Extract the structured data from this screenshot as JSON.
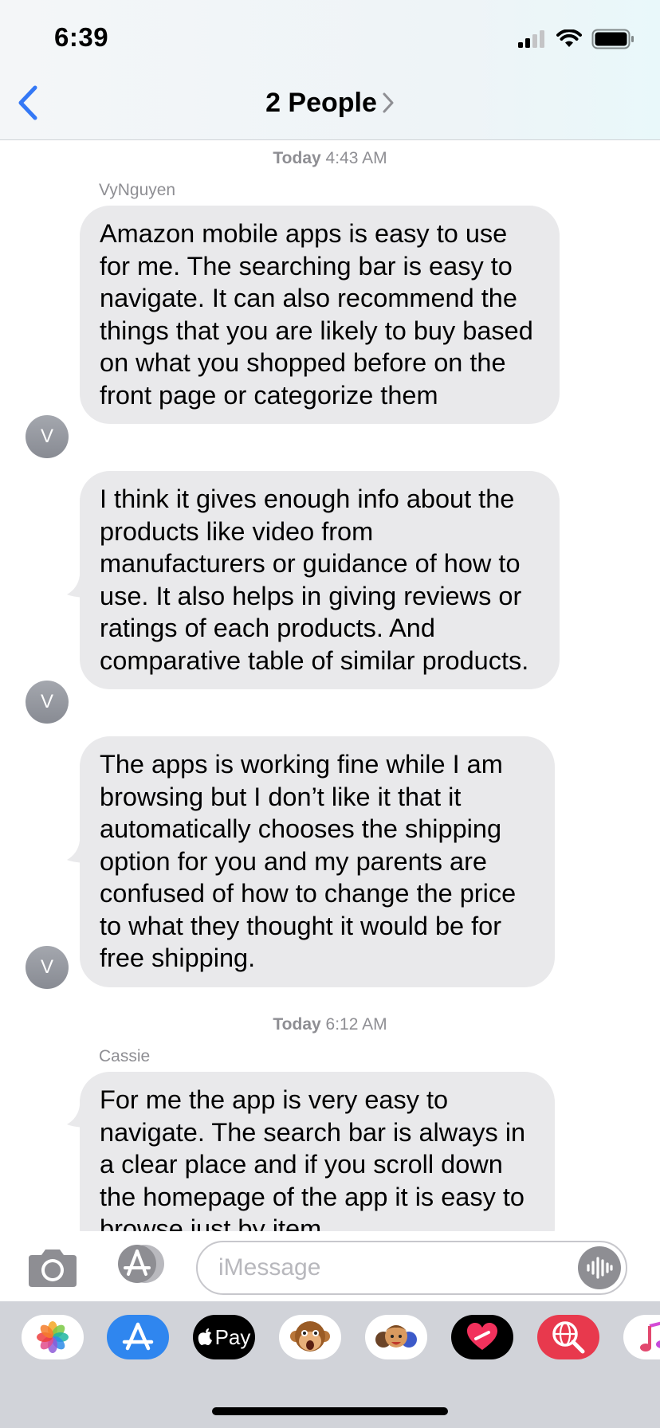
{
  "status_bar": {
    "time": "6:39"
  },
  "nav": {
    "title": "2 People"
  },
  "conversation": {
    "sections": [
      {
        "day": "Today",
        "time": "4:43 AM"
      },
      {
        "day": "Today",
        "time": "6:12 AM"
      }
    ],
    "senders": [
      "VyNguyen",
      "Cassie"
    ],
    "avatar_initial": "V",
    "messages": [
      "Amazon mobile apps is easy to use for me. The searching bar is easy to navigate. It can also recommend the things that you are likely to buy based on what you shopped before on the front page or categorize them",
      "I think it gives enough info about the products like video from manufacturers or guidance of how to use. It also helps in giving reviews or ratings of each products. And comparative table of similar products.",
      "The apps is working fine while I am browsing but I don’t like it that it automatically chooses the shipping option for you and my parents are confused of how to change the price to what they thought it would be for free shipping.",
      "For me the app is very easy to navigate. The search bar is always in a clear place and if you scroll down the homepage of the app it is easy to browse just by item"
    ]
  },
  "input": {
    "placeholder": "iMessage"
  },
  "drawer": {
    "apple_pay_label": "Pay",
    "apps": [
      "photos-app",
      "app-store-app",
      "apple-pay-app",
      "animoji-app",
      "memoji-app",
      "digital-touch-app",
      "web-images-search-app",
      "music-app"
    ]
  },
  "colors": {
    "accent_blue": "#3478f6",
    "bubble_gray": "#e9e9eb",
    "meta_gray": "#8e8e93",
    "drawer_bg": "#d1d3d9"
  }
}
